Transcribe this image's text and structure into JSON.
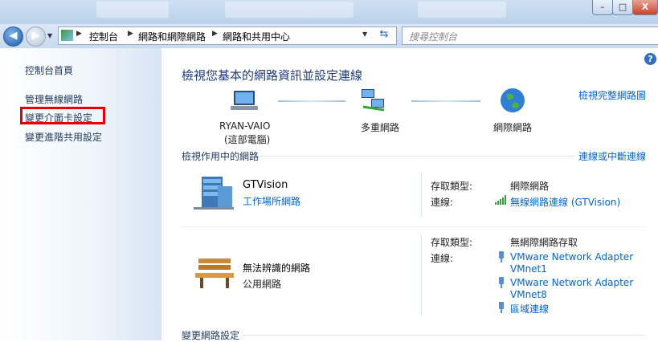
{
  "window": {
    "minimize_label": "–",
    "maximize_label": "□",
    "close_label": "X"
  },
  "nav": {
    "back_icon": "back-arrow-icon",
    "forward_icon": "forward-arrow-icon",
    "breadcrumbs": [
      "控制台",
      "網路和網際網路",
      "網路和共用中心"
    ],
    "search_placeholder": "搜尋控制台"
  },
  "sidebar": {
    "items": [
      {
        "label": "控制台首頁"
      },
      {
        "label": "管理無線網路"
      },
      {
        "label": "變更介面卡設定"
      },
      {
        "label": "變更進階共用設定"
      }
    ]
  },
  "main": {
    "help_label": "?",
    "title": "檢視您基本的網路資訊並設定連線",
    "view_full_map": "檢視完整網路圖",
    "map": {
      "computer_name": "RYAN-VAIO",
      "computer_sub": "(這部電腦)",
      "multiple": "多重網路",
      "internet": "網際網路"
    },
    "active_header": "檢視作用中的網路",
    "connect_link": "連線或中斷連線",
    "networks": [
      {
        "name": "GTVision",
        "category": "工作場所網路",
        "access_label": "存取類型:",
        "access_value": "網際網路",
        "conn_label": "連線:",
        "connections": [
          "無線網路連線 (GTVision)"
        ]
      },
      {
        "name": "無法辨識的網路",
        "category": "公用網路",
        "access_label": "存取類型:",
        "access_value": "無網際網路存取",
        "conn_label": "連線:",
        "connections": [
          "VMware Network Adapter",
          "VMnet1",
          "VMware Network Adapter",
          "VMnet8",
          "區域連線"
        ]
      }
    ],
    "change_settings_header": "變更網路設定"
  }
}
